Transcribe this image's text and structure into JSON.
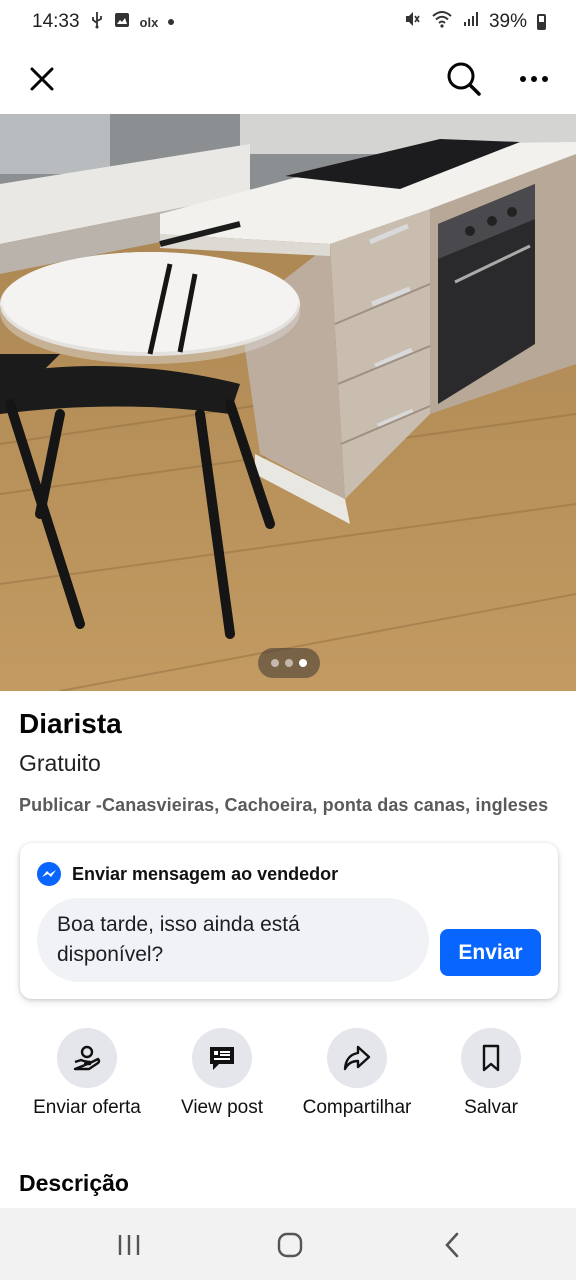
{
  "status_bar": {
    "time": "14:33",
    "left_icons": [
      "usb-icon",
      "image-icon",
      "olx-icon",
      "dot-icon"
    ],
    "olx_text": "olx",
    "battery_percent": "39%",
    "right_icons": [
      "mute-icon",
      "wifi-icon",
      "signal-icon",
      "battery-icon"
    ]
  },
  "top_nav": {
    "icons": [
      "close-icon",
      "search-icon",
      "more-icon"
    ]
  },
  "photo": {
    "pager": {
      "total": 3,
      "active_index": 2
    }
  },
  "listing": {
    "title": "Diarista",
    "price": "Gratuito",
    "location": "Publicar -Canasvieiras, Cachoeira, ponta das canas, ingleses"
  },
  "message": {
    "title": "Enviar mensagem ao vendedor",
    "icon": "messenger-icon",
    "input_value": "Boa tarde, isso ainda está disponível?",
    "send_label": "Enviar",
    "colors": {
      "send_button": "#0866ff",
      "input_bg": "#f0f2f5"
    }
  },
  "actions": [
    {
      "label": "Enviar oferta",
      "icon": "offer-icon"
    },
    {
      "label": "View post",
      "icon": "post-icon"
    },
    {
      "label": "Compartilhar",
      "icon": "share-icon"
    },
    {
      "label": "Salvar",
      "icon": "bookmark-icon"
    }
  ],
  "description": {
    "title": "Descrição"
  },
  "bottom_nav": {
    "icons": [
      "recent-apps-icon",
      "home-icon",
      "back-icon"
    ]
  }
}
